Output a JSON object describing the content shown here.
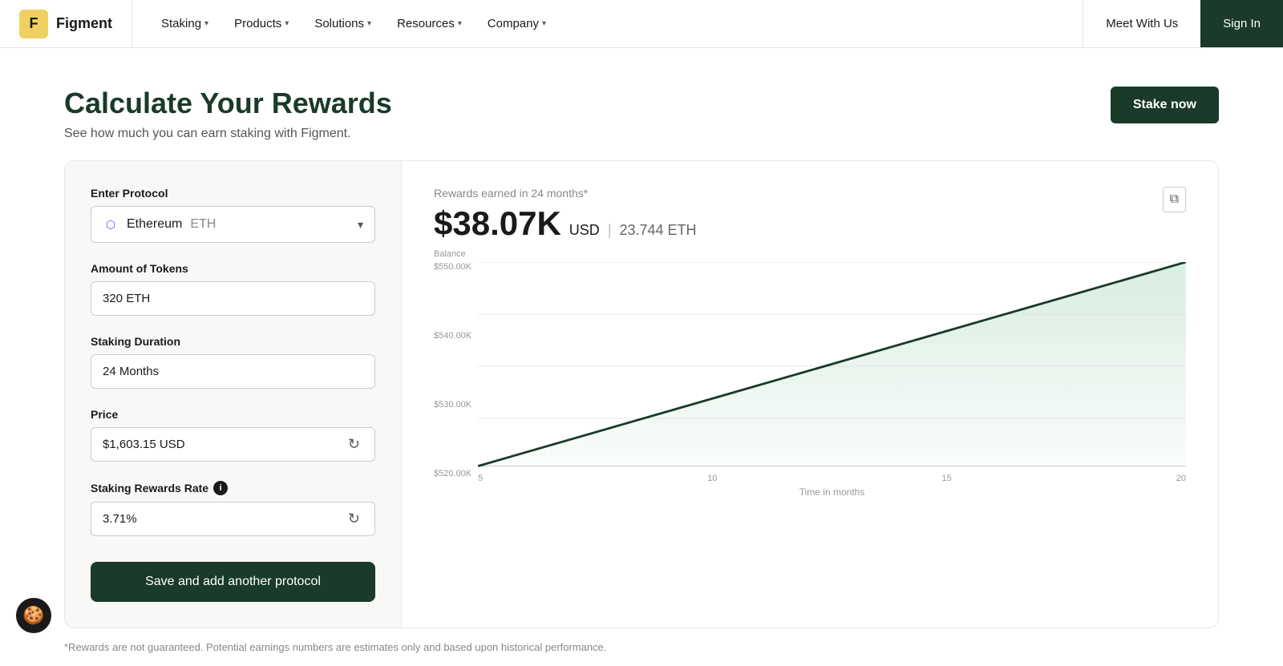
{
  "nav": {
    "logo_letter": "F",
    "logo_name": "Figment",
    "links": [
      {
        "label": "Staking",
        "has_chevron": true
      },
      {
        "label": "Products",
        "has_chevron": true
      },
      {
        "label": "Solutions",
        "has_chevron": true
      },
      {
        "label": "Resources",
        "has_chevron": true
      },
      {
        "label": "Company",
        "has_chevron": true
      }
    ],
    "meet_label": "Meet With Us",
    "signin_label": "Sign In"
  },
  "hero": {
    "title": "Calculate Your Rewards",
    "subtitle": "See how much you can earn staking with Figment.",
    "stake_label": "Stake now"
  },
  "calculator": {
    "protocol_label": "Enter Protocol",
    "protocol_value": "Ethereum",
    "protocol_symbol": "ETH",
    "tokens_label": "Amount of Tokens",
    "tokens_value": "320 ETH",
    "duration_label": "Staking Duration",
    "duration_value": "24 Months",
    "price_label": "Price",
    "price_value": "$1,603.15 USD",
    "rate_label": "Staking Rewards Rate",
    "rate_value": "3.71%",
    "save_label": "Save and add another protocol"
  },
  "results": {
    "label": "Rewards earned in 24 months*",
    "amount_usd": "$38.07K",
    "currency_usd": "USD",
    "amount_eth": "23.744 ETH"
  },
  "chart": {
    "balance_label": "Balance",
    "y_ticks": [
      "$550.00K",
      "$540.00K",
      "$530.00K",
      "$520.00K"
    ],
    "x_ticks": [
      "5",
      "10",
      "15",
      "20"
    ],
    "x_label": "Time in months"
  },
  "disclaimer": "*Rewards are not guaranteed. Potential earnings numbers are estimates only and based upon historical performance."
}
